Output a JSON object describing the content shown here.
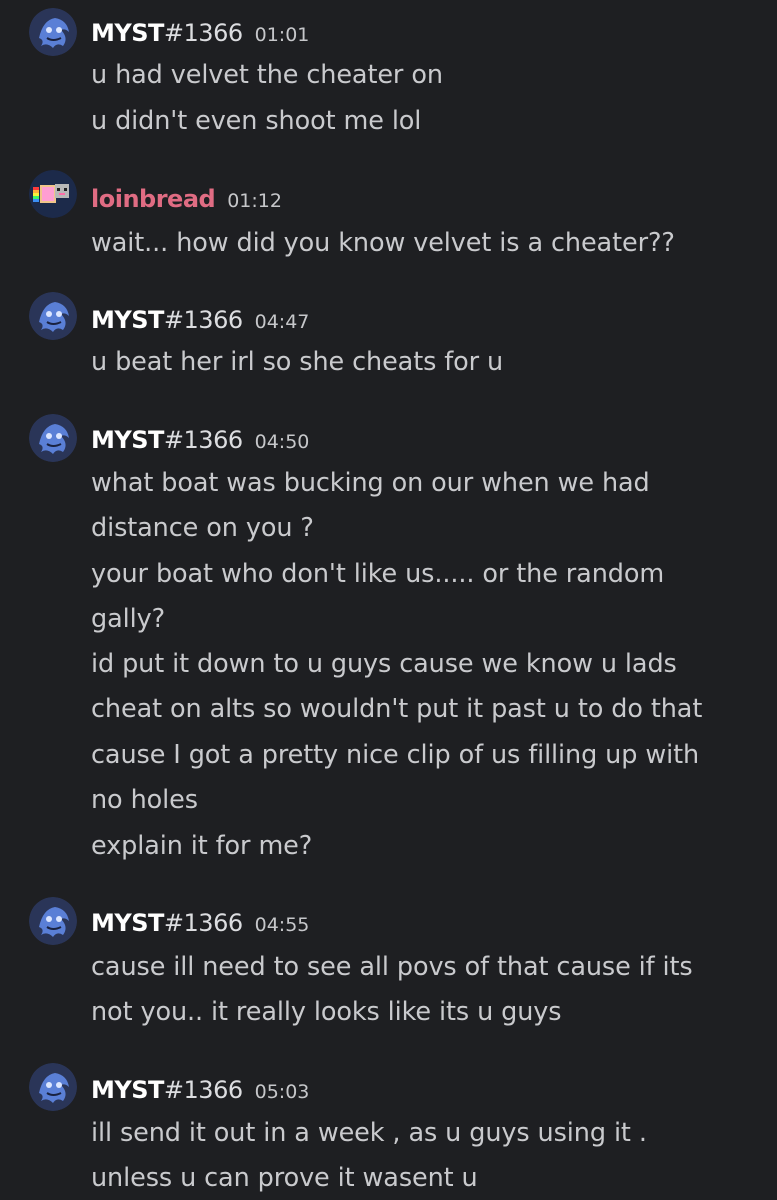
{
  "messages": [
    {
      "author": {
        "name": "MYST",
        "discriminator": "#1366"
      },
      "time": "01:01",
      "lines": [
        "u had velvet the cheater on",
        "u didn't even shoot me lol"
      ]
    },
    {
      "author": {
        "name": "loinbread",
        "discriminator": ""
      },
      "time": "01:12",
      "lines": [
        "wait... how did you know velvet is a cheater??"
      ]
    },
    {
      "author": {
        "name": "MYST",
        "discriminator": "#1366"
      },
      "time": "04:47",
      "lines": [
        "u beat her irl so she cheats for u"
      ]
    },
    {
      "author": {
        "name": "MYST",
        "discriminator": "#1366"
      },
      "time": "04:50",
      "lines": [
        "what boat was bucking on our when we had",
        "distance on you ?",
        "your boat who don't like us..... or the random",
        "gally?",
        "id put it down to u guys cause we know u lads",
        "cheat on alts so wouldn't put it past u to do that",
        "cause I got a pretty nice clip of us filling up with",
        "no holes",
        "explain it for me?"
      ]
    },
    {
      "author": {
        "name": "MYST",
        "discriminator": "#1366"
      },
      "time": "04:55",
      "lines": [
        "cause ill need to see all povs of that cause if its",
        "not you.. it really looks like its u guys"
      ]
    },
    {
      "author": {
        "name": "MYST",
        "discriminator": "#1366"
      },
      "time": "05:03",
      "lines": [
        "ill send it out in a week , as u guys using it .",
        "unless u can prove it wasent u"
      ]
    }
  ],
  "colors": {
    "background": "#1e1f22",
    "username_default": "#ffffff",
    "username_loinbread": "#e06c83",
    "message_text": "#c9cacd",
    "timestamp": "#c6c7ca"
  },
  "icons": {
    "myst_avatar": "blue-creature-avatar-icon",
    "loinbread_avatar": "pixel-cat-avatar-icon"
  }
}
